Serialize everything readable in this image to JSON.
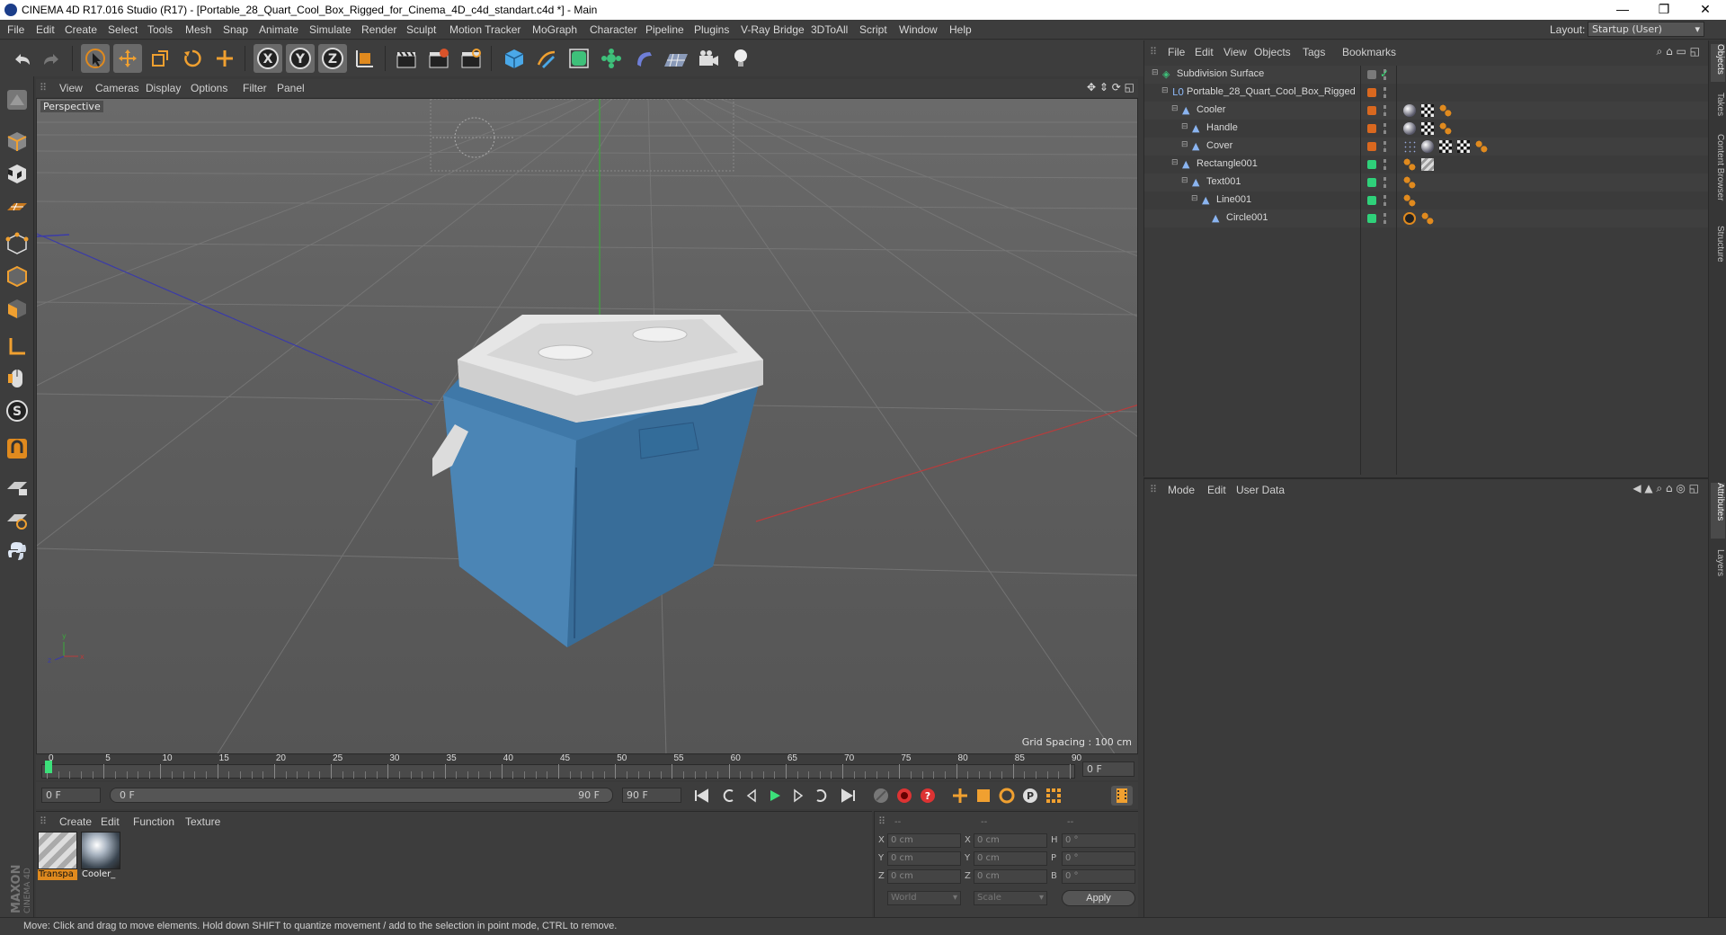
{
  "window": {
    "title": "CINEMA 4D R17.016 Studio (R17) - [Portable_28_Quart_Cool_Box_Rigged_for_Cinema_4D_c4d_standart.c4d *] - Main",
    "minimize": "—",
    "restore": "❐",
    "close": "✕"
  },
  "menubar": {
    "items": [
      "File",
      "Edit",
      "Create",
      "Select",
      "Tools",
      "Mesh",
      "Snap",
      "Animate",
      "Simulate",
      "Render",
      "Sculpt",
      "Motion Tracker",
      "MoGraph",
      "Character",
      "Pipeline",
      "Plugins",
      "V-Ray Bridge",
      "3DToAll",
      "Script",
      "Window",
      "Help"
    ],
    "layout_label": "Layout:",
    "layout_value": "Startup (User)"
  },
  "viewport": {
    "menu": [
      "View",
      "Cameras",
      "Display",
      "Options",
      "Filter",
      "Panel"
    ],
    "label": "Perspective",
    "grid_spacing": "Grid Spacing : 100 cm"
  },
  "timeline": {
    "ticks": [
      "0",
      "5",
      "10",
      "15",
      "20",
      "25",
      "30",
      "35",
      "40",
      "45",
      "50",
      "55",
      "60",
      "65",
      "70",
      "75",
      "80",
      "85",
      "90"
    ],
    "current_frame": "0 F",
    "start_field": "0 F",
    "slider_start": "0 F",
    "slider_end": "90 F",
    "end_field": "90 F"
  },
  "material_manager": {
    "menu": [
      "Create",
      "Edit",
      "Function",
      "Texture"
    ],
    "materials": [
      {
        "label": "Transpa",
        "selected": true
      },
      {
        "label": "Cooler_",
        "selected": false
      }
    ]
  },
  "coordinates": {
    "headers": [
      "--",
      "--",
      "--"
    ],
    "rows": [
      {
        "a": "X",
        "av": "0 cm",
        "b": "X",
        "bv": "0 cm",
        "c": "H",
        "cv": "0 °"
      },
      {
        "a": "Y",
        "av": "0 cm",
        "b": "Y",
        "bv": "0 cm",
        "c": "P",
        "cv": "0 °"
      },
      {
        "a": "Z",
        "av": "0 cm",
        "b": "Z",
        "bv": "0 cm",
        "c": "B",
        "cv": "0 °"
      }
    ],
    "world": "World",
    "scale": "Scale",
    "apply": "Apply"
  },
  "object_manager": {
    "menu": [
      "File",
      "Edit",
      "View",
      "Objects",
      "Tags",
      "Bookmarks"
    ],
    "objects": [
      {
        "name": "Subdivision Surface",
        "color": "#7a7a7a",
        "indent": 0
      },
      {
        "name": "Portable_28_Quart_Cool_Box_Rigged",
        "color": "#d9681f",
        "indent": 1
      },
      {
        "name": "Cooler",
        "color": "#d9681f",
        "indent": 2
      },
      {
        "name": "Handle",
        "color": "#d9681f",
        "indent": 3
      },
      {
        "name": "Cover",
        "color": "#d9681f",
        "indent": 3
      },
      {
        "name": "Rectangle001",
        "color": "#2fd17a",
        "indent": 2
      },
      {
        "name": "Text001",
        "color": "#2fd17a",
        "indent": 3
      },
      {
        "name": "Line001",
        "color": "#2fd17a",
        "indent": 4
      },
      {
        "name": "Circle001",
        "color": "#2fd17a",
        "indent": 5
      }
    ]
  },
  "attribute_manager": {
    "menu": [
      "Mode",
      "Edit",
      "User Data"
    ]
  },
  "right_tabs": [
    "Objects",
    "Takes",
    "Content Browser",
    "Structure",
    "Attributes",
    "Layers"
  ],
  "maxon_logo": "MAXON CINEMA 4D",
  "status": "Move: Click and drag to move elements. Hold down SHIFT to quantize movement / add to the selection in point mode, CTRL to remove.",
  "colors": {
    "cooler_blue": "#3f78a8",
    "lid_white": "#e4e4e4",
    "accent_orange": "#e08a1e"
  }
}
